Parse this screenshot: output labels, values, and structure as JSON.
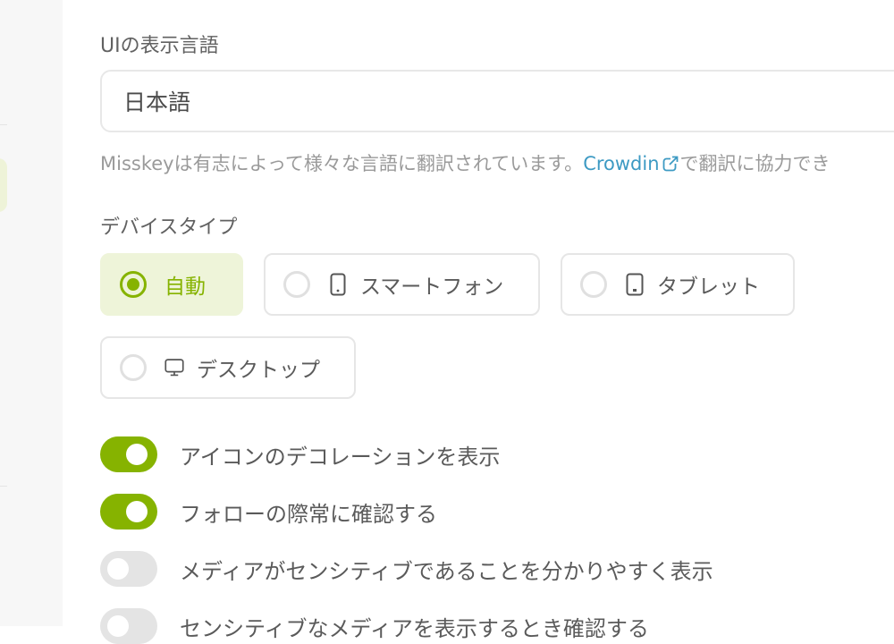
{
  "language": {
    "label": "UIの表示言語",
    "selected": "日本語",
    "caption_prefix": "Misskeyは有志によって様々な言語に翻訳されています。",
    "caption_link": "Crowdin",
    "caption_suffix": "で翻訳に協力でき"
  },
  "device_type": {
    "label": "デバイスタイプ",
    "options": [
      {
        "label": "自動",
        "checked": true,
        "icon": null
      },
      {
        "label": "スマートフォン",
        "checked": false,
        "icon": "smartphone-icon"
      },
      {
        "label": "タブレット",
        "checked": false,
        "icon": "tablet-icon"
      },
      {
        "label": "デスクトップ",
        "checked": false,
        "icon": "desktop-icon"
      }
    ]
  },
  "toggles": [
    {
      "label": "アイコンのデコレーションを表示",
      "on": true
    },
    {
      "label": "フォローの際常に確認する",
      "on": true
    },
    {
      "label": "メディアがセンシティブであることを分かりやすく表示",
      "on": false
    },
    {
      "label": "センシティブなメディアを表示するとき確認する",
      "on": false
    }
  ],
  "colors": {
    "accent": "#86b300",
    "link": "#3d9ac3",
    "checked_bg": "#eef4d9"
  }
}
